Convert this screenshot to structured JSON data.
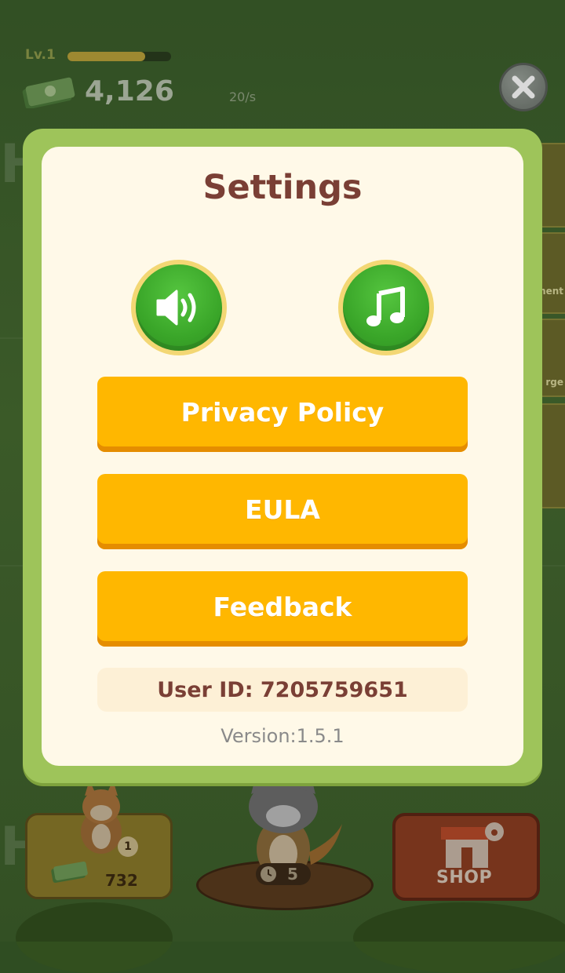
{
  "background": {
    "level_label": "Lv.1",
    "xp_progress": 0.75,
    "money_value": "4,126",
    "rate_label": "20/s",
    "side_tab_labels": [
      "ment",
      "rge"
    ],
    "pet_card": {
      "badge": "1",
      "count": "732"
    },
    "timer_value": "5",
    "shop_label": "SHOP"
  },
  "settings": {
    "title": "Settings",
    "sound_toggle_icon": "speaker-icon",
    "music_toggle_icon": "music-note-icon",
    "buttons": [
      {
        "label": "Privacy Policy"
      },
      {
        "label": "EULA"
      },
      {
        "label": "Feedback"
      }
    ],
    "user_id": "User ID: 7205759651",
    "version": "Version:1.5.1"
  },
  "colors": {
    "frame_green": "#9ec45a",
    "panel_cream": "#fff9e8",
    "title_brown": "#7a3f35",
    "button_orange": "#ffb700",
    "toggle_green": "#3aa629"
  }
}
